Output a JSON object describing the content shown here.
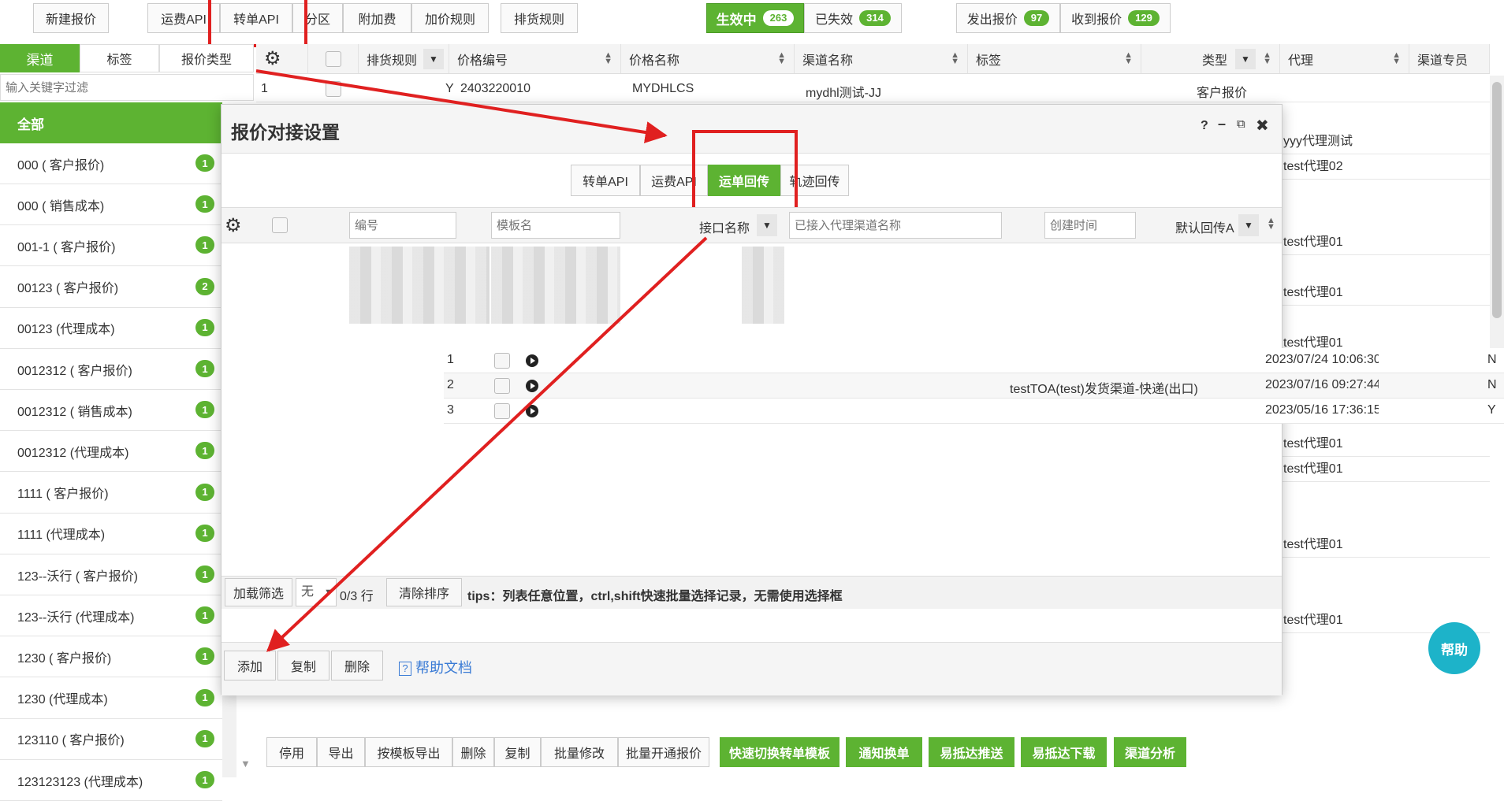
{
  "toolbar": {
    "new_quote": "新建报价",
    "tab_freight_api": "运费API",
    "tab_transfer_api": "转单API",
    "tab_zone": "分区",
    "tab_surcharge": "附加费",
    "tab_markup_rule": "加价规则",
    "tab_cargo_rule": "排货规则",
    "status_active": "生效中",
    "status_active_count": "263",
    "status_expired": "已失效",
    "status_expired_count": "314",
    "sent_quotes": "发出报价",
    "sent_count": "97",
    "received_quotes": "收到报价",
    "received_count": "129"
  },
  "sidebar": {
    "tabs": [
      "渠道",
      "标签",
      "报价类型"
    ],
    "search_placeholder": "输入关键字过滤",
    "all_label": "全部",
    "items": [
      {
        "label": "000 ( 客户报价)",
        "count": "1"
      },
      {
        "label": "000 ( 销售成本)",
        "count": "1"
      },
      {
        "label": "001-1 ( 客户报价)",
        "count": "1"
      },
      {
        "label": "00123 ( 客户报价)",
        "count": "2"
      },
      {
        "label": "00123 (代理成本)",
        "count": "1"
      },
      {
        "label": "0012312 ( 客户报价)",
        "count": "1"
      },
      {
        "label": "0012312 ( 销售成本)",
        "count": "1"
      },
      {
        "label": "0012312 (代理成本)",
        "count": "1"
      },
      {
        "label": "1111 ( 客户报价)",
        "count": "1"
      },
      {
        "label": "1111 (代理成本)",
        "count": "1"
      },
      {
        "label": "123--沃行 ( 客户报价)",
        "count": "1"
      },
      {
        "label": "123--沃行 (代理成本)",
        "count": "1"
      },
      {
        "label": "1230 ( 客户报价)",
        "count": "1"
      },
      {
        "label": "1230 (代理成本)",
        "count": "1"
      },
      {
        "label": "123110 ( 客户报价)",
        "count": "1"
      },
      {
        "label": "123123123 (代理成本)",
        "count": "1"
      }
    ]
  },
  "main_grid": {
    "headers": [
      "排货规则",
      "价格编号",
      "价格名称",
      "渠道名称",
      "标签",
      "类型",
      "代理",
      "渠道专员"
    ],
    "first_row": {
      "num": "1",
      "rule": "Y",
      "code": "2403220010",
      "name": "MYDHLCS",
      "channel": "mydhl测试-JJ",
      "type": "客户报价"
    },
    "agent_column": [
      "yyy代理测试",
      "test代理02",
      "test代理01",
      "test代理01",
      "test代理01",
      "test代理01",
      "test代理01",
      "test代理01",
      "test代理01",
      "test代理01"
    ]
  },
  "dialog": {
    "title": "报价对接设置",
    "tabs": [
      "转单API",
      "运费API",
      "运单回传",
      "轨迹回传"
    ],
    "active_tab": "运单回传",
    "filter_code_placeholder": "编号",
    "filter_template_placeholder": "模板名",
    "col_interface": "接口名称",
    "filter_channel_placeholder": "已接入代理渠道名称",
    "filter_created_placeholder": "创建时间",
    "col_default": "默认回传A",
    "rows": [
      {
        "num": "1",
        "channel": "",
        "created": "2023/07/24 10:06:30",
        "default": "N"
      },
      {
        "num": "2",
        "channel": "testTOA(test)发货渠道-快递(出口)",
        "created": "2023/07/16 09:27:44",
        "default": "N"
      },
      {
        "num": "3",
        "channel": "",
        "created": "2023/05/16 17:36:15",
        "default": "Y"
      }
    ],
    "footer": {
      "load_filter": "加载筛选",
      "filter_value": "无",
      "row_count": "0/3 行",
      "clear_sort": "清除排序",
      "tips": "tips：列表任意位置，ctrl,shift快速批量选择记录，无需使用选择框"
    },
    "actions": {
      "add": "添加",
      "copy": "复制",
      "delete": "删除",
      "help_doc": "帮助文档"
    }
  },
  "bottom_bar": {
    "buttons": [
      "停用",
      "导出",
      "按模板导出",
      "删除",
      "复制",
      "批量修改",
      "批量开通报价"
    ],
    "green_buttons": [
      "快速切换转单模板",
      "通知换单",
      "易抵达推送",
      "易抵达下载",
      "渠道分析"
    ]
  },
  "help_fab": "帮助",
  "colors": {
    "green": "#5db332",
    "annotation_red": "#e02020",
    "fab": "#1db3c9"
  }
}
